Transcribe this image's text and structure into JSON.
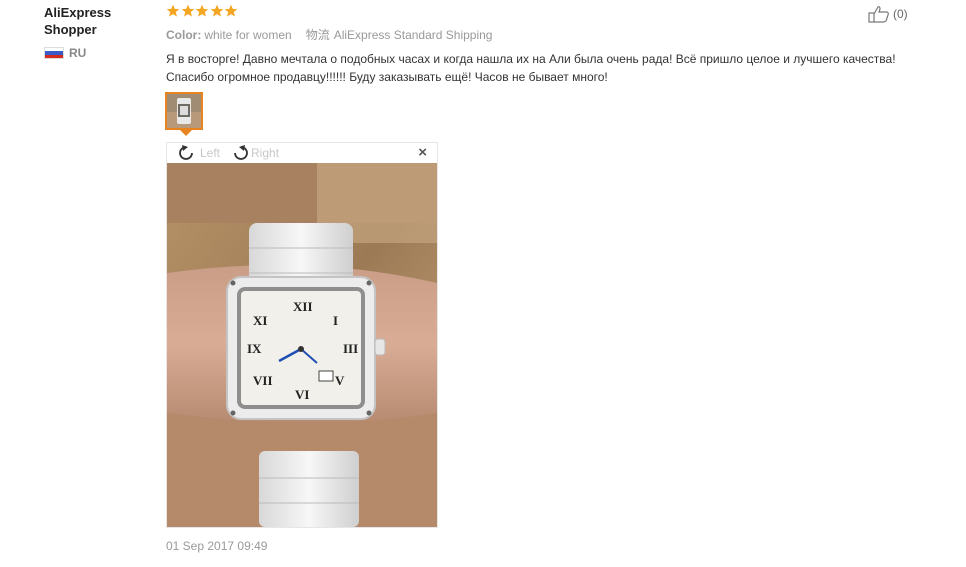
{
  "user": {
    "name": "AliExpress\nShopper",
    "country_code": "RU"
  },
  "rating": {
    "stars": 5,
    "color": "#f4a623"
  },
  "meta": {
    "color_label": "Color:",
    "color_value": "white for women",
    "shipping_icon_text": "物流",
    "shipping_value": "AliExpress Standard Shipping"
  },
  "helpful": {
    "count_text": "(0)"
  },
  "review": {
    "text": "Я в восторге! Давно мечтала о подобных часах и когда нашла их на Али была очень рада! Всё пришло целое и лучшего качества! Спасибо огромное продавцу!!!!!! Буду заказывать ещё! Часов не бывает много!",
    "date": "01 Sep 2017 09:49"
  },
  "viewer": {
    "rotate_left_label": "Left",
    "rotate_right_label": "Right",
    "close_label": "×"
  },
  "colors": {
    "accent": "#e8841f",
    "star": "#f4a623"
  }
}
